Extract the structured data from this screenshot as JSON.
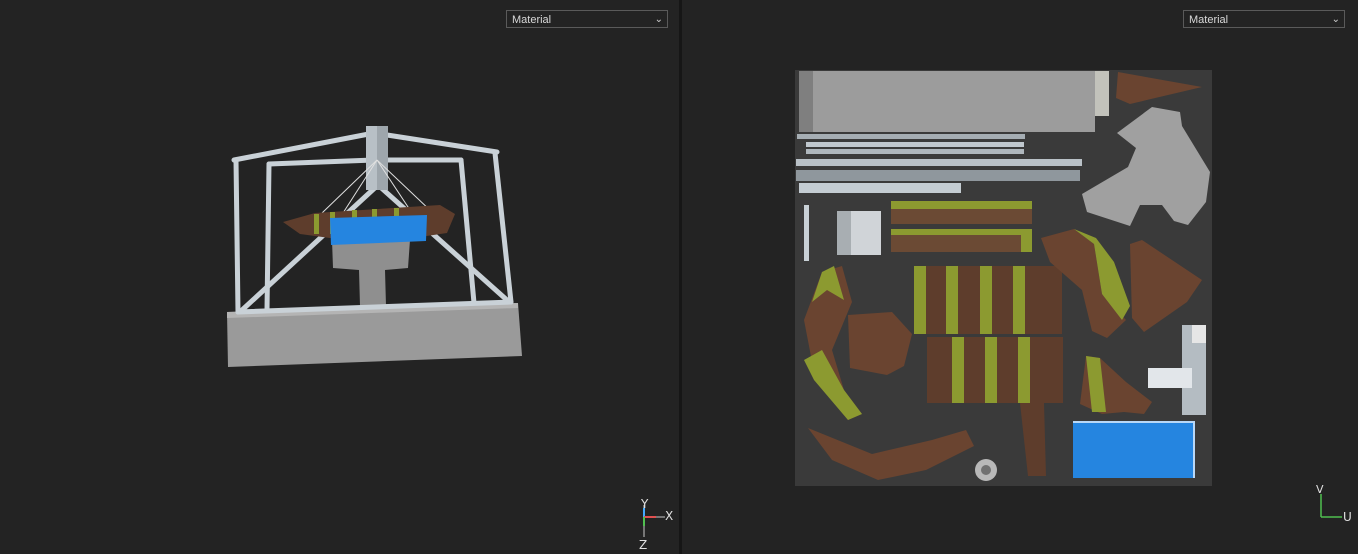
{
  "viewport3d": {
    "mode_select": {
      "value": "Material"
    },
    "gizmo": {
      "y": "Y",
      "x": "X",
      "z": "Z"
    }
  },
  "uv_editor": {
    "mode_select": {
      "value": "Material"
    },
    "gizmo": {
      "v": "V",
      "u": "U"
    }
  },
  "colors": {
    "background": "#232323",
    "water": "#2585e0",
    "concrete": "#9c9c9c",
    "wood": "#5e3d2c",
    "moss": "#8c9a30",
    "frame": "#c8d0d6"
  },
  "icons": [
    "chevron-down-icon",
    "axis-gizmo-icon",
    "uv-axis-gizmo-icon"
  ]
}
